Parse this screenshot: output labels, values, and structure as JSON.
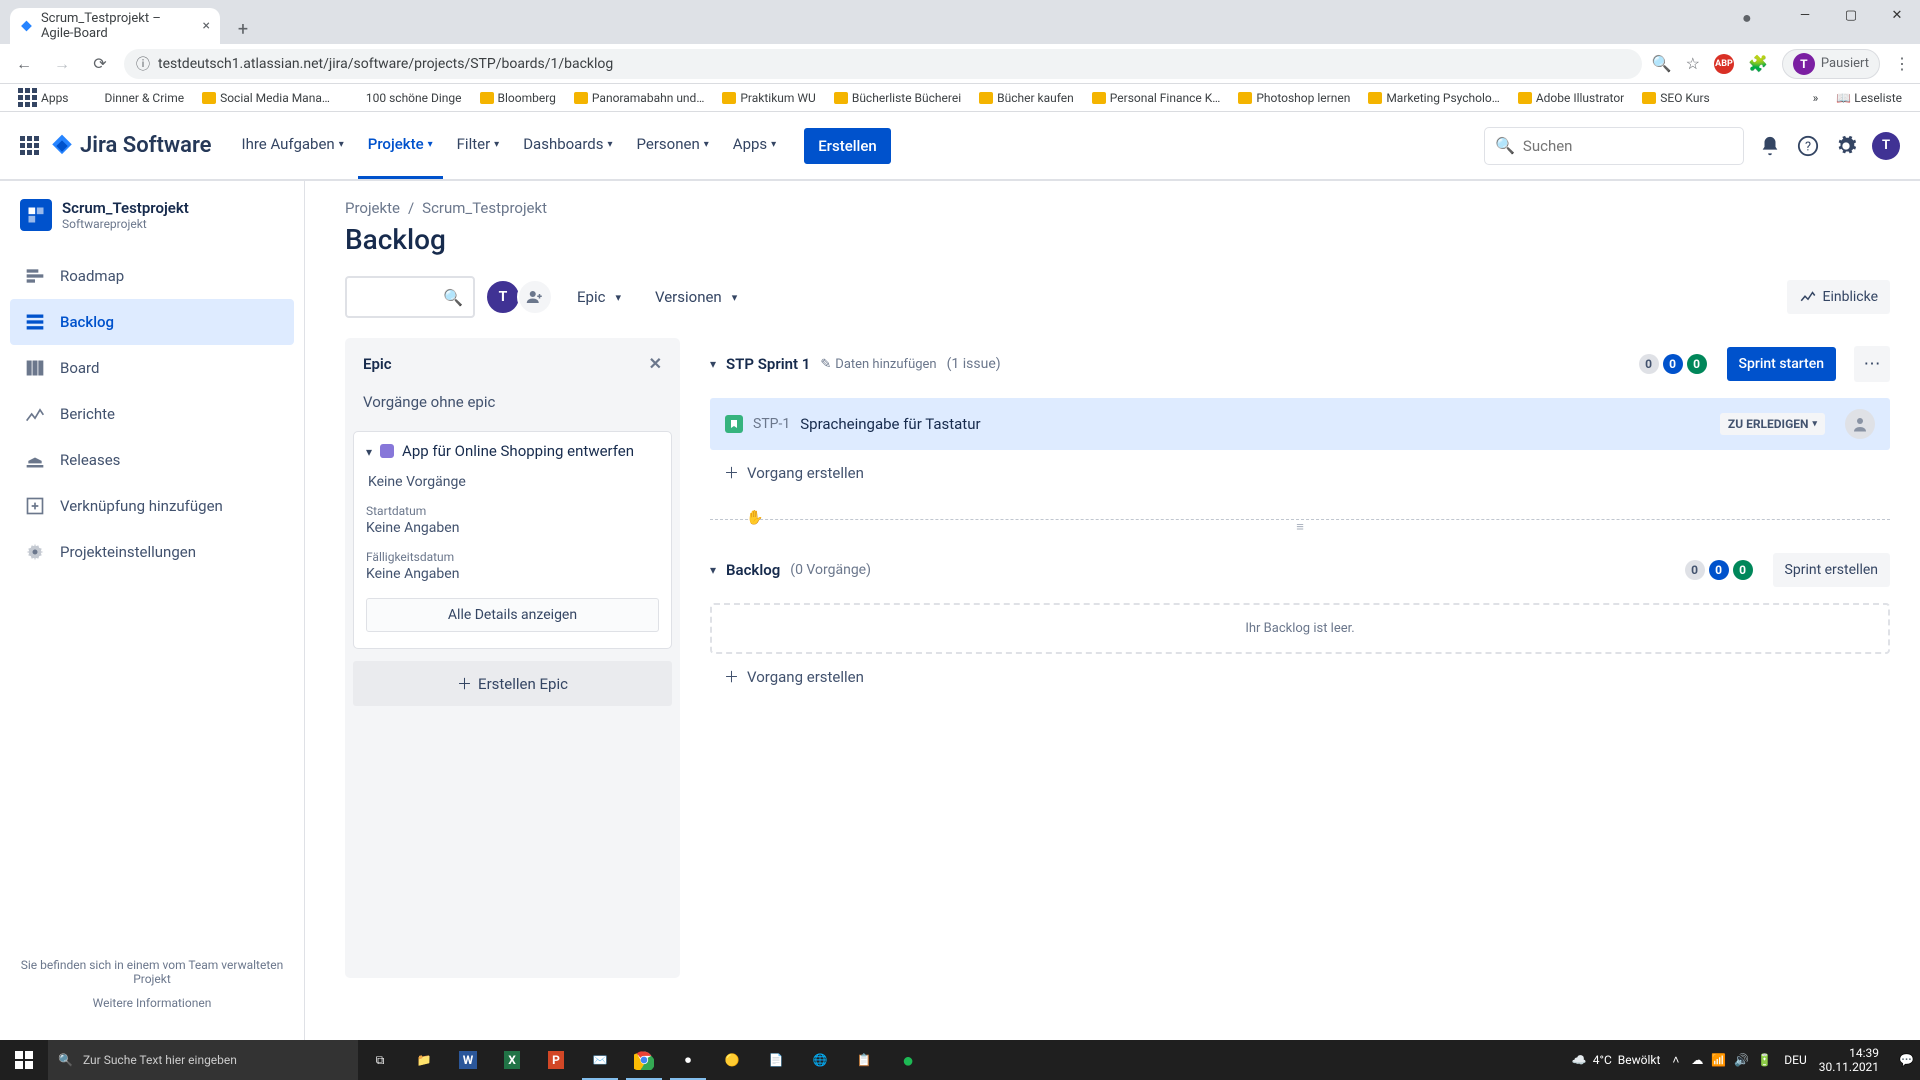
{
  "browser": {
    "tab_title": "Scrum_Testprojekt – Agile-Board",
    "url": "testdeutsch1.atlassian.net/jira/software/projects/STP/boards/1/backlog",
    "user_badge": "Pausiert",
    "user_badge_initial": "T",
    "bookmarks": [
      "Apps",
      "Dinner & Crime",
      "Social Media Mana…",
      "100 schöne Dinge",
      "Bloomberg",
      "Panoramabahn und…",
      "Praktikum WU",
      "Bücherliste Bücherei",
      "Bücher kaufen",
      "Personal Finance K…",
      "Photoshop lernen",
      "Marketing Psycholo…",
      "Adobe Illustrator",
      "SEO Kurs"
    ],
    "reading_list": "Leseliste"
  },
  "jira_nav": {
    "logo": "Jira Software",
    "items": [
      "Ihre Aufgaben",
      "Projekte",
      "Filter",
      "Dashboards",
      "Personen",
      "Apps"
    ],
    "active": "Projekte",
    "create": "Erstellen",
    "search_placeholder": "Suchen"
  },
  "sidebar": {
    "project_name": "Scrum_Testprojekt",
    "project_type": "Softwareprojekt",
    "items": [
      {
        "label": "Roadmap"
      },
      {
        "label": "Backlog",
        "active": true
      },
      {
        "label": "Board"
      },
      {
        "label": "Berichte"
      },
      {
        "label": "Releases"
      },
      {
        "label": "Verknüpfung hinzufügen"
      },
      {
        "label": "Projekteinstellungen"
      }
    ],
    "footer_text": "Sie befinden sich in einem vom Team verwalteten Projekt",
    "footer_link": "Weitere Informationen"
  },
  "main": {
    "breadcrumb1": "Projekte",
    "breadcrumb2": "Scrum_Testprojekt",
    "page_title": "Backlog",
    "filter_epic": "Epic",
    "filter_versions": "Versionen",
    "insights": "Einblicke",
    "avatar_initial": "T"
  },
  "epic_panel": {
    "title": "Epic",
    "no_epic": "Vorgänge ohne epic",
    "epic_name": "App für Online Shopping entwerfen",
    "no_issues": "Keine Vorgänge",
    "start_label": "Startdatum",
    "start_value": "Keine Angaben",
    "due_label": "Fälligkeitsdatum",
    "due_value": "Keine Angaben",
    "details_btn": "Alle Details anzeigen",
    "create_epic": "Erstellen Epic"
  },
  "sprint": {
    "name": "STP Sprint 1",
    "add_dates": "Daten hinzufügen",
    "count": "(1 issue)",
    "pill_gray": "0",
    "pill_blue": "0",
    "pill_green": "0",
    "start_btn": "Sprint starten",
    "issue_key": "STP-1",
    "issue_summary": "Spracheingabe für Tastatur",
    "issue_status": "ZU ERLEDIGEN",
    "create_issue": "Vorgang erstellen"
  },
  "backlog": {
    "name": "Backlog",
    "count": "(0 Vorgänge)",
    "pill_gray": "0",
    "pill_blue": "0",
    "pill_green": "0",
    "create_sprint": "Sprint erstellen",
    "empty": "Ihr Backlog ist leer.",
    "create_issue": "Vorgang erstellen"
  },
  "taskbar": {
    "search_placeholder": "Zur Suche Text hier eingeben",
    "weather_temp": "4°C",
    "weather_cond": "Bewölkt",
    "lang": "DEU",
    "time": "14:39",
    "date": "30.11.2021"
  }
}
